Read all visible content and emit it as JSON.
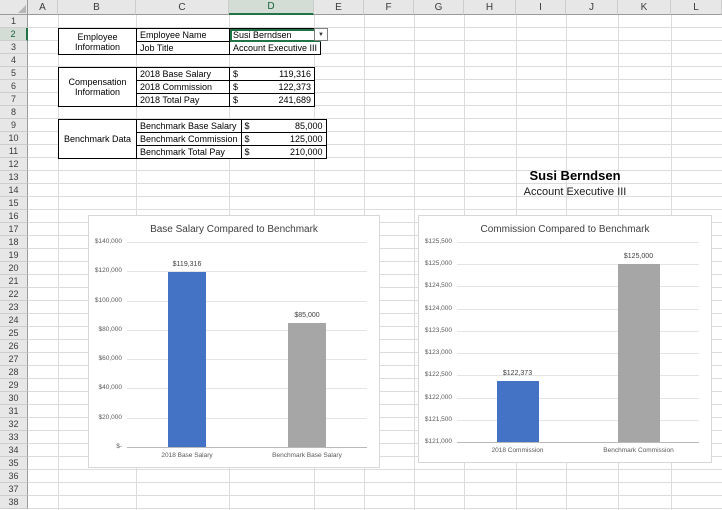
{
  "grid": {
    "columns": [
      "A",
      "B",
      "C",
      "D",
      "E",
      "F",
      "G",
      "H",
      "I",
      "J",
      "K",
      "L"
    ],
    "rows": 38,
    "selected_column": "D",
    "selected_row": 2
  },
  "icons": {
    "dropdown_arrow": "▼"
  },
  "colors": {
    "selection_green": "#217346",
    "bar_blue": "#4472c4",
    "bar_gray": "#a6a6a6",
    "header_bg": "#e7e7e7",
    "gridline": "#dcdcdc"
  },
  "tables": [
    {
      "name": "employee-information",
      "label": "Employee Information",
      "rows": [
        {
          "field": "Employee Name",
          "value": "Susi Berndsen",
          "selected": true,
          "dropdown": true
        },
        {
          "field": "Job Title",
          "value": "Account Executive III"
        }
      ]
    },
    {
      "name": "compensation-information",
      "label": "Compensation Information",
      "rows": [
        {
          "field": "2018 Base Salary",
          "currency": "$",
          "value": "119,316"
        },
        {
          "field": "2018 Commission",
          "currency": "$",
          "value": "122,373"
        },
        {
          "field": "2018 Total Pay",
          "currency": "$",
          "value": "241,689"
        }
      ]
    },
    {
      "name": "benchmark-data",
      "label": "Benchmark Data",
      "rows": [
        {
          "field": "Benchmark Base Salary",
          "currency": "$",
          "value": "85,000"
        },
        {
          "field": "Benchmark Commission",
          "currency": "$",
          "value": "125,000"
        },
        {
          "field": "Benchmark Total Pay",
          "currency": "$",
          "value": "210,000"
        }
      ]
    }
  ],
  "heading": {
    "name": "Susi Berndsen",
    "title": "Account Executive III"
  },
  "chart_data": [
    {
      "type": "bar",
      "title": "Base Salary Compared to Benchmark",
      "categories": [
        "2018 Base Salary",
        "Benchmark Base Salary"
      ],
      "values": [
        119316,
        85000
      ],
      "data_labels": [
        "$119,316",
        "$85,000"
      ],
      "bar_colors": [
        "#4472c4",
        "#a6a6a6"
      ],
      "ylim": [
        0,
        140000
      ],
      "ytick_step": 20000,
      "ytick_labels": [
        "$-",
        "$20,000",
        "$40,000",
        "$60,000",
        "$80,000",
        "$100,000",
        "$120,000",
        "$140,000"
      ],
      "grid": true,
      "legend": "none"
    },
    {
      "type": "bar",
      "title": "Commission Compared to Benchmark",
      "categories": [
        "2018 Commission",
        "Benchmark Commission"
      ],
      "values": [
        122373,
        125000
      ],
      "data_labels": [
        "$122,373",
        "$125,000"
      ],
      "bar_colors": [
        "#4472c4",
        "#a6a6a6"
      ],
      "ylim": [
        121000,
        125500
      ],
      "ytick_step": 500,
      "ytick_labels": [
        "$121,000",
        "$121,500",
        "$122,000",
        "$122,500",
        "$123,000",
        "$123,500",
        "$124,000",
        "$124,500",
        "$125,000",
        "$125,500"
      ],
      "grid": true,
      "legend": "none"
    }
  ]
}
